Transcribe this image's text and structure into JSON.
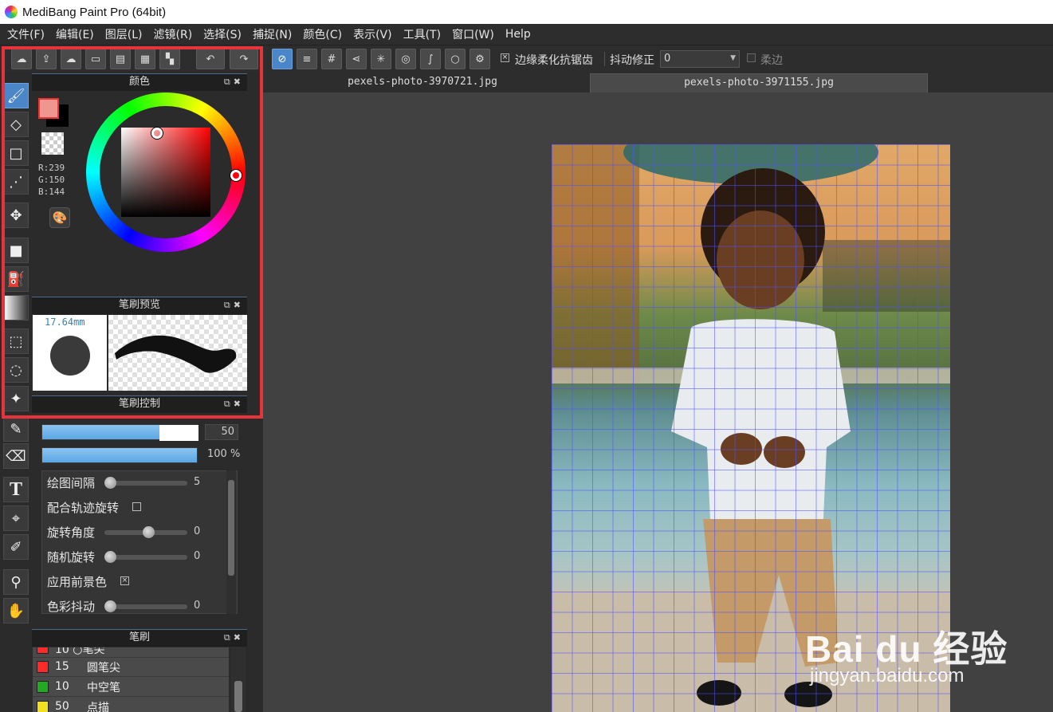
{
  "window": {
    "title": "MediBang Paint Pro (64bit)"
  },
  "menu": [
    "文件(F)",
    "编辑(E)",
    "图层(L)",
    "滤镜(R)",
    "选择(S)",
    "捕捉(N)",
    "颜色(C)",
    "表示(V)",
    "工具(T)",
    "窗口(W)",
    "Help"
  ],
  "toolbar": {
    "antialias_label": "边缘柔化抗锯齿",
    "antialias_checked": true,
    "stabilizer_label": "抖动修正",
    "stabilizer_value": "0",
    "soft_edge_label": "柔边",
    "soft_edge_checked": false
  },
  "tabs": [
    {
      "label": "pexels-photo-3970721.jpg",
      "active": false
    },
    {
      "label": "pexels-photo-3971155.jpg",
      "active": true
    }
  ],
  "color_panel": {
    "title": "颜色",
    "r": "R:239",
    "g": "G:150",
    "b": "B:144",
    "foreground_color": "#ef9690",
    "background_color": "#000000"
  },
  "brush_preview": {
    "title": "笔刷预览",
    "size": "17.64mm"
  },
  "brush_control": {
    "title": "笔刷控制",
    "size_value": "50",
    "size_fraction": 0.75,
    "opacity_value": "100 %",
    "opacity_fraction": 1.0,
    "properties": [
      {
        "label": "绘图间隔",
        "type": "slider",
        "value": "5",
        "fraction": 0.0
      },
      {
        "label": "配合轨迹旋转",
        "type": "checkbox",
        "checked": false
      },
      {
        "label": "旋转角度",
        "type": "slider",
        "value": "0",
        "fraction": 0.5
      },
      {
        "label": "随机旋转",
        "type": "slider",
        "value": "0",
        "fraction": 0.0
      },
      {
        "label": "应用前景色",
        "type": "checkbox",
        "checked": true
      },
      {
        "label": "色彩抖动",
        "type": "slider",
        "value": "0",
        "fraction": 0.0
      }
    ]
  },
  "brush_panel": {
    "title": "笔刷",
    "partial_top": "10 ○笔尖",
    "items": [
      {
        "num": "15",
        "name": "圆笔尖",
        "color": "#ff2a2a"
      },
      {
        "num": "10",
        "name": "中空笔",
        "color": "#22aa22"
      },
      {
        "num": "50",
        "name": "点描",
        "color": "#f0e020"
      }
    ]
  },
  "watermark": {
    "main": "Bai du 经验",
    "sub": "jingyan.baidu.com"
  },
  "colors": {
    "accent": "#4a86c8",
    "highlight": "#e8333a"
  }
}
